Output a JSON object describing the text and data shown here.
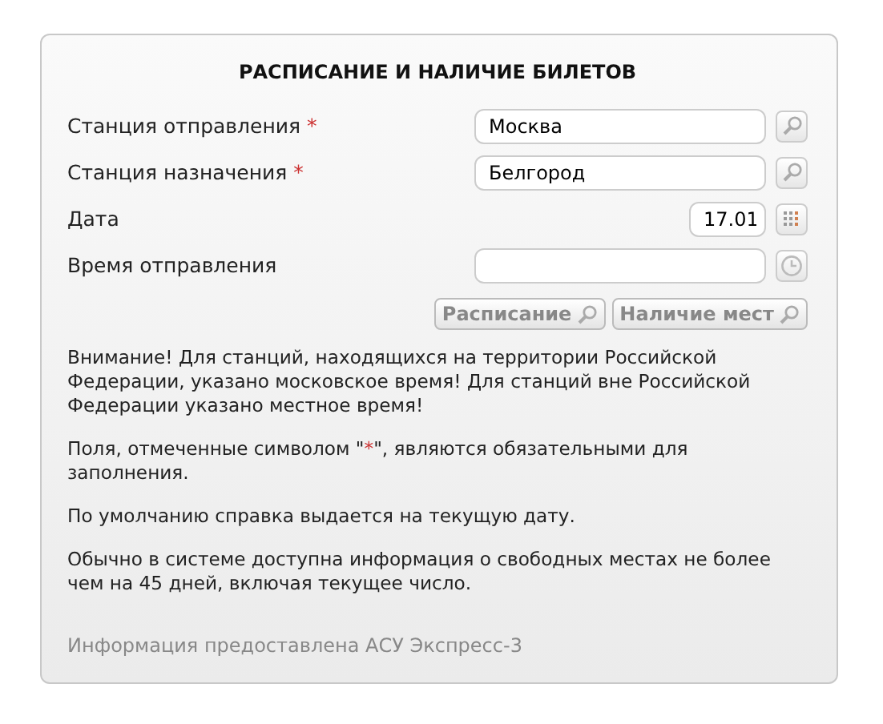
{
  "title": "РАСПИСАНИЕ И НАЛИЧИЕ БИЛЕТОВ",
  "fields": [
    {
      "label": "Станция отправления",
      "mark": "*",
      "kind": "station",
      "value": "Москва"
    },
    {
      "label": "Станция назначения",
      "mark": "*",
      "kind": "station",
      "value": "Белгород"
    },
    {
      "label": "Дата",
      "kind": "date",
      "value": "17.01"
    },
    {
      "label": "Время отправления",
      "kind": "time"
    }
  ],
  "buttons": [
    {
      "label": "Расписание",
      "disabled": true
    },
    {
      "label": "Наличие мест",
      "disabled": true
    }
  ],
  "notes": [
    {
      "parts": [
        {
          "text": "Внимание! Для станций, находящихся на территории Российской Федерации, указано московское время! Для станций вне Российской Федерации указано местное время!"
        }
      ]
    },
    {
      "parts": [
        {
          "text": "Поля, отмеченные символом \""
        },
        {
          "text": "*",
          "kind": "mark"
        },
        {
          "text": "\", являются обязательными для заполнения."
        }
      ]
    },
    {
      "parts": [
        {
          "text": "По умолчанию справка выдается на текущую дату."
        }
      ]
    },
    {
      "parts": [
        {
          "text": "Обычно в системе доступна информация о свободных местах не более чем на 45 дней, включая текущее число."
        }
      ]
    }
  ],
  "footer": "Информация предоставлена АСУ Экспресс-3"
}
